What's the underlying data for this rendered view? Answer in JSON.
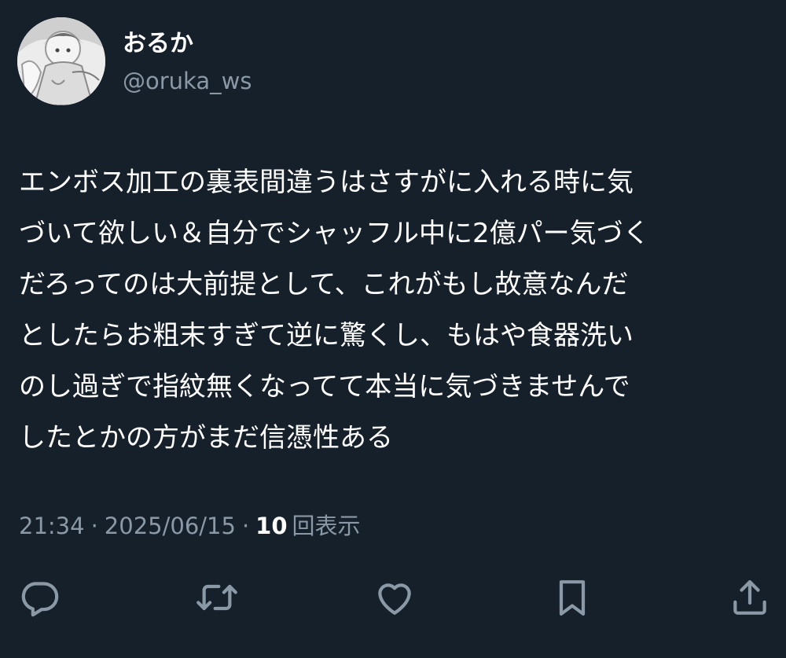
{
  "author": {
    "display_name": "おるか",
    "handle": "@oruka_ws",
    "avatar_icon": "avatar-illustration"
  },
  "tweet": {
    "lines": [
      "エンボス加工の裏表間違うはさすがに入れる時に気",
      "づいて欲しい＆自分でシャッフル中に2億パー気づく",
      "だろってのは大前提として、これがもし故意なんだ",
      "としたらお粗末すぎて逆に驚くし、もはや食器洗い",
      "のし過ぎで指紋無くなってて本当に気づきませんで",
      "したとかの方がまだ信憑性ある"
    ]
  },
  "meta": {
    "time": "21:34",
    "separator": "·",
    "date": "2025/06/15",
    "views_count": "10",
    "views_label": "回表示"
  },
  "actions": [
    {
      "name": "reply",
      "icon": "reply-icon"
    },
    {
      "name": "retweet",
      "icon": "retweet-icon"
    },
    {
      "name": "like",
      "icon": "heart-icon"
    },
    {
      "name": "bookmark",
      "icon": "bookmark-icon"
    },
    {
      "name": "share",
      "icon": "share-icon"
    }
  ],
  "colors": {
    "background": "#15202b",
    "primary_text": "#ffffff",
    "secondary_text": "#8b98a5",
    "icon": "#8b98a5"
  }
}
